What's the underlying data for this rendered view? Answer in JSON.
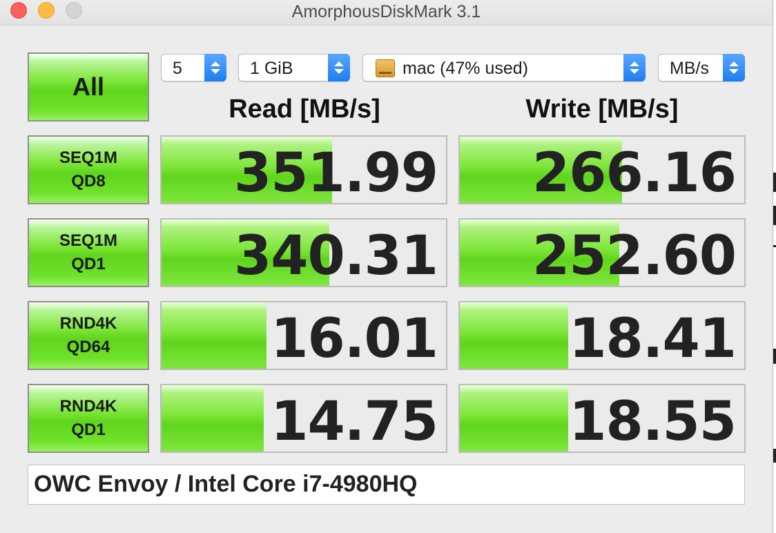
{
  "window": {
    "title": "AmorphousDiskMark 3.1"
  },
  "controls": {
    "all_button": "All",
    "count": "5",
    "size": "1 GiB",
    "drive": "mac (47% used)",
    "unit": "MB/s"
  },
  "headers": {
    "read": "Read [MB/s]",
    "write": "Write [MB/s]"
  },
  "tests": [
    {
      "line1": "SEQ1M",
      "line2": "QD8",
      "read": "351.99",
      "write": "266.16",
      "read_fill": 0.6,
      "write_fill": 0.57
    },
    {
      "line1": "SEQ1M",
      "line2": "QD1",
      "read": "340.31",
      "write": "252.60",
      "read_fill": 0.59,
      "write_fill": 0.56
    },
    {
      "line1": "RND4K",
      "line2": "QD64",
      "read": "16.01",
      "write": "18.41",
      "read_fill": 0.37,
      "write_fill": 0.38
    },
    {
      "line1": "RND4K",
      "line2": "QD1",
      "read": "14.75",
      "write": "18.55",
      "read_fill": 0.36,
      "write_fill": 0.38
    }
  ],
  "comment": "OWC Envoy / Intel Core i7-4980HQ",
  "colors": {
    "green": "#6fe22a",
    "stepper_blue": "#1e7cf2",
    "close": "#fc605c",
    "minimize": "#fdbc40",
    "zoom_disabled": "#d4d4d4"
  }
}
